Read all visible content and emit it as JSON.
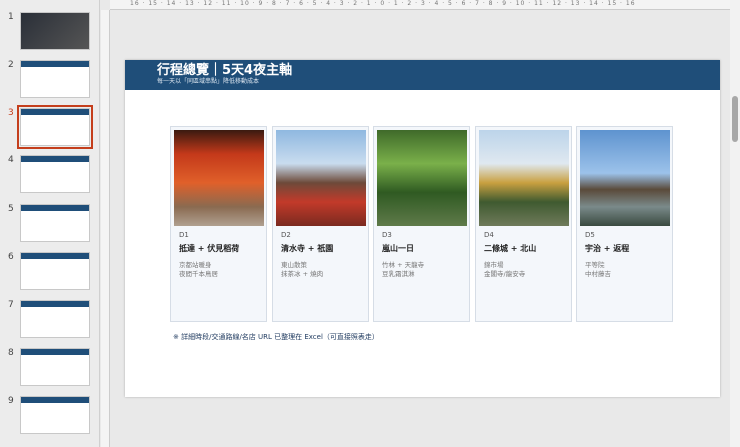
{
  "thumbnails": [
    {
      "num": "1"
    },
    {
      "num": "2"
    },
    {
      "num": "3",
      "active": true
    },
    {
      "num": "4"
    },
    {
      "num": "5"
    },
    {
      "num": "6"
    },
    {
      "num": "7"
    },
    {
      "num": "8"
    },
    {
      "num": "9"
    }
  ],
  "ruler": "16 · 15 · 14 · 13 · 12 · 11 · 10 · 9 · 8 · 7 · 6 · 5 · 4 · 3 · 2 · 1 · 0 · 1 · 2 · 3 · 4 · 5 · 6 · 7 · 8 · 9 · 10 · 11 · 12 · 13 · 14 · 15 · 16",
  "slide": {
    "title": "行程總覽｜5天4夜主軸",
    "subtitle": "每一天以「同區域串點」降低移動成本",
    "cards": [
      {
        "day": "D1",
        "title": "抵達 + 伏見稻荷",
        "lines": [
          "京都站暖身",
          "夜間千本鳥居"
        ]
      },
      {
        "day": "D2",
        "title": "清水寺 + 祇園",
        "lines": [
          "東山散策",
          "抹茶冰 + 燒肉"
        ]
      },
      {
        "day": "D3",
        "title": "嵐山一日",
        "lines": [
          "竹林 + 天龍寺",
          "豆乳霜淇淋"
        ]
      },
      {
        "day": "D4",
        "title": "二條城 + 北山",
        "lines": [
          "錦市場",
          "金閣寺/龍安寺"
        ]
      },
      {
        "day": "D5",
        "title": "宇治 + 返程",
        "lines": [
          "平等院",
          "中村藤吉"
        ]
      }
    ],
    "note": "※ 詳細時段/交通路線/名店 URL 已整理在 Excel（可直接照表走）"
  },
  "colors": {
    "header": "#1f4e79",
    "accent": "#c43e1c"
  }
}
